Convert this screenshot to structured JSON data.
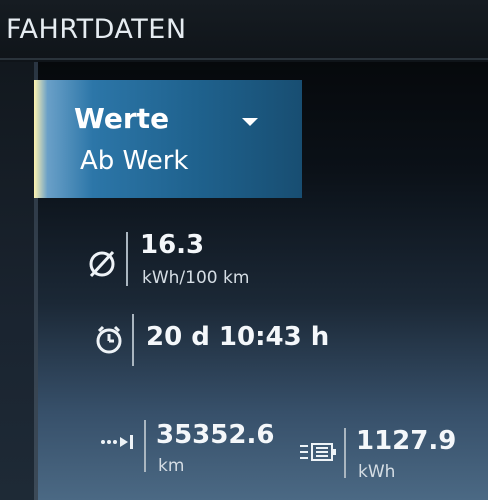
{
  "header": {
    "title": "FAHRTDATEN"
  },
  "selector": {
    "label": "Werte",
    "value": "Ab Werk",
    "icon": "chevron-down-icon"
  },
  "stats": {
    "consumption": {
      "icon": "average-icon",
      "value": "16.3",
      "unit": "kWh/100 km"
    },
    "drive_time": {
      "icon": "stopwatch-icon",
      "value": "20 d 10:43 h"
    },
    "distance": {
      "icon": "distance-icon",
      "value": "35352.6",
      "unit": "km"
    },
    "energy": {
      "icon": "battery-flow-icon",
      "value": "1127.9",
      "unit": "kWh"
    }
  },
  "colors": {
    "accent": "#2c76a8",
    "highlight": "#fff3b0",
    "text": "#f2f5f8"
  }
}
